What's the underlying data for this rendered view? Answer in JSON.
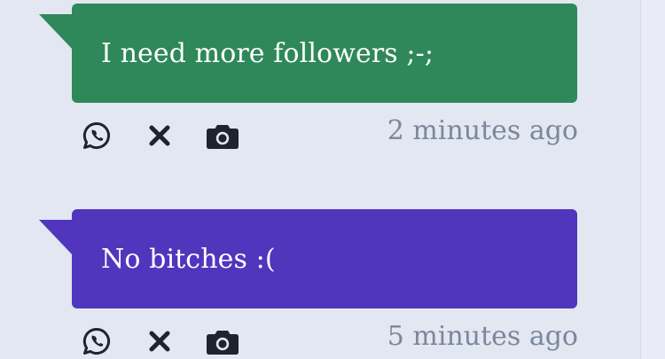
{
  "posts": [
    {
      "message": "I need more followers ;-;",
      "time": "2 minutes ago",
      "color": "#2f8859"
    },
    {
      "message": "No bitches :(",
      "time": "5 minutes ago",
      "color": "#4f36bd"
    }
  ],
  "actions": [
    {
      "icon": "whatsapp-icon"
    },
    {
      "icon": "close-icon"
    },
    {
      "icon": "camera-icon"
    }
  ],
  "colors": {
    "background": "#e2e7f1",
    "icon": "#1f232d",
    "timestamp": "#7b879c"
  }
}
